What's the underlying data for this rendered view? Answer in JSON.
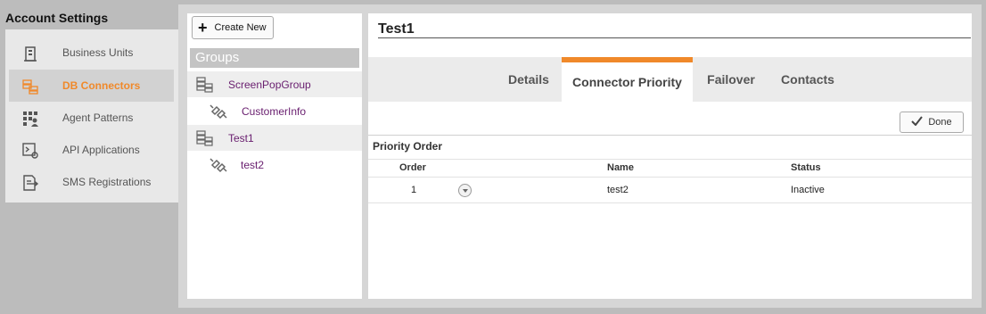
{
  "settings": {
    "title": "Account Settings",
    "items": [
      {
        "label": "Business Units",
        "icon": "building-icon"
      },
      {
        "label": "DB Connectors",
        "icon": "db-connectors-icon",
        "active": true
      },
      {
        "label": "Agent Patterns",
        "icon": "agent-patterns-icon"
      },
      {
        "label": "API Applications",
        "icon": "api-applications-icon"
      },
      {
        "label": "SMS Registrations",
        "icon": "sms-registrations-icon"
      }
    ]
  },
  "groups": {
    "create_label": "Create New",
    "header": "Groups",
    "tree": [
      {
        "label": "ScreenPopGroup",
        "type": "group"
      },
      {
        "label": "CustomerInfo",
        "type": "connector"
      },
      {
        "label": "Test1",
        "type": "group"
      },
      {
        "label": "test2",
        "type": "connector"
      }
    ]
  },
  "content": {
    "title": "Test1",
    "tabs": [
      {
        "label": "Details"
      },
      {
        "label": "Connector Priority",
        "active": true
      },
      {
        "label": "Failover"
      },
      {
        "label": "Contacts"
      }
    ],
    "done_label": "Done",
    "section_title": "Priority Order",
    "table": {
      "headers": [
        "Order",
        "Name",
        "Status"
      ],
      "rows": [
        {
          "order": "1",
          "name": "test2",
          "status": "Inactive"
        }
      ]
    }
  },
  "colors": {
    "accent": "#f0892a",
    "link": "#6a2070"
  }
}
